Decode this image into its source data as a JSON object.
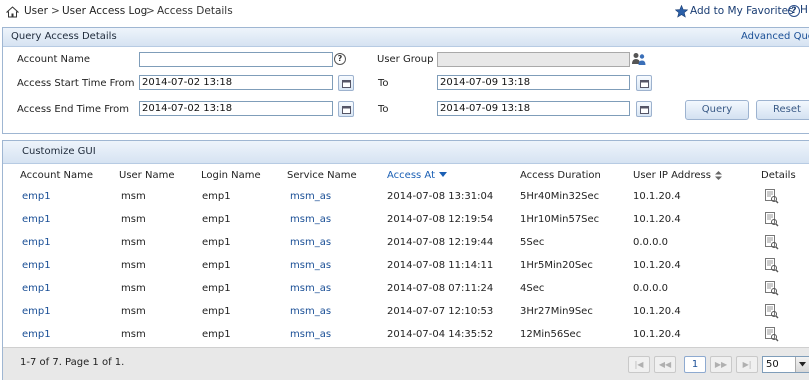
{
  "breadcrumb": {
    "item1": "User",
    "item2": "User Access Log",
    "item3": "Access Details",
    "sep": ">"
  },
  "header": {
    "favorites_label": "Add to My Favorites",
    "help_label": "H"
  },
  "query": {
    "title": "Query Access Details",
    "advanced_label": "Advanced Que",
    "account_name_label": "Account Name",
    "account_name_value": "",
    "user_group_label": "User Group",
    "user_group_value": "",
    "start_from_label": "Access Start Time From",
    "start_from_value": "2014-07-02 13:18",
    "start_to_label": "To",
    "start_to_value": "2014-07-09 13:18",
    "end_from_label": "Access End Time From",
    "end_from_value": "2014-07-02 13:18",
    "end_to_label": "To",
    "end_to_value": "2014-07-09 13:18",
    "query_button": "Query",
    "reset_button": "Reset"
  },
  "results": {
    "title": "Customize GUI",
    "columns": [
      "Account Name",
      "User Name",
      "Login Name",
      "Service Name",
      "Access At",
      "Access Duration",
      "User IP Address",
      "Details"
    ],
    "sorted_column_index": 4,
    "rows": [
      [
        "emp1",
        "msm",
        "emp1",
        "msm_as",
        "2014-07-08 13:31:04",
        "5Hr40Min32Sec",
        "10.1.20.4"
      ],
      [
        "emp1",
        "msm",
        "emp1",
        "msm_as",
        "2014-07-08 12:19:54",
        "1Hr10Min57Sec",
        "10.1.20.4"
      ],
      [
        "emp1",
        "msm",
        "emp1",
        "msm_as",
        "2014-07-08 12:19:44",
        "5Sec",
        "0.0.0.0"
      ],
      [
        "emp1",
        "msm",
        "emp1",
        "msm_as",
        "2014-07-08 11:14:11",
        "1Hr5Min20Sec",
        "10.1.20.4"
      ],
      [
        "emp1",
        "msm",
        "emp1",
        "msm_as",
        "2014-07-08 07:11:24",
        "4Sec",
        "0.0.0.0"
      ],
      [
        "emp1",
        "msm",
        "emp1",
        "msm_as",
        "2014-07-07 12:10:53",
        "3Hr27Min9Sec",
        "10.1.20.4"
      ],
      [
        "emp1",
        "msm",
        "emp1",
        "msm_as",
        "2014-07-04 14:35:52",
        "12Min56Sec",
        "10.1.20.4"
      ]
    ],
    "pagination_info": "1-7 of 7. Page 1 of 1.",
    "current_page": "1",
    "page_size": "50"
  },
  "colors": {
    "accent": "#1a4f96",
    "panel_header": "#d6e3f2",
    "border": "#9fb6d2"
  }
}
